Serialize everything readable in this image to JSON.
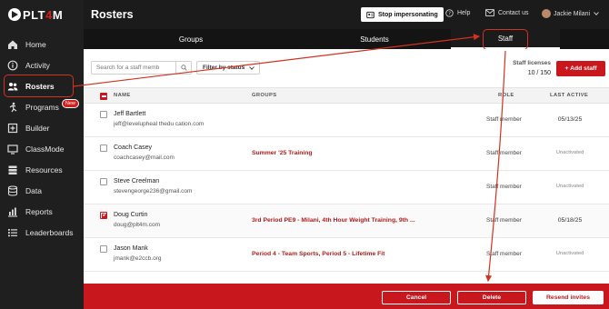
{
  "sidebar": {
    "logo_prefix": "PLT",
    "logo_red": "4",
    "logo_suffix": "M",
    "items": [
      {
        "label": "Home",
        "icon": "home-icon"
      },
      {
        "label": "Activity",
        "icon": "activity-icon"
      },
      {
        "label": "Rosters",
        "icon": "users-icon"
      },
      {
        "label": "Programs",
        "icon": "programs-icon",
        "badge": "New"
      },
      {
        "label": "Builder",
        "icon": "builder-icon"
      },
      {
        "label": "ClassMode",
        "icon": "classmode-icon"
      },
      {
        "label": "Resources",
        "icon": "resources-icon"
      },
      {
        "label": "Data",
        "icon": "data-icon"
      },
      {
        "label": "Reports",
        "icon": "reports-icon"
      },
      {
        "label": "Leaderboards",
        "icon": "leaderboards-icon"
      }
    ]
  },
  "header": {
    "title": "Rosters",
    "stop_impersonating": "Stop impersonating",
    "help": "Help",
    "contact": "Contact us",
    "user": "Jackie Milani"
  },
  "tabs": [
    "Groups",
    "Students",
    "Staff"
  ],
  "toolbar": {
    "search_placeholder": "Search for a staff memb",
    "filter_label": "Filter by status",
    "licenses_label": "Staff licenses",
    "licenses_count": "10 / 150",
    "add_staff": "+ Add staff"
  },
  "table": {
    "headers": {
      "name": "NAME",
      "groups": "GROUPS",
      "role": "ROLE",
      "last_active": "LAST ACTIVE"
    },
    "rows": [
      {
        "name": "Jeff Bartlett",
        "email": "jeff@levelupheal thedu cation.com",
        "groups": "",
        "role": "Staff member",
        "last_active": "05/13/25",
        "checked": false
      },
      {
        "name": "Coach Casey",
        "email": "coachcasey@mail.com",
        "groups": "Summer '25 Training",
        "role": "Staff member",
        "last_active": "Unactivated",
        "checked": false
      },
      {
        "name": "Steve Creelman",
        "email": "stevengeorge236@gmail.com",
        "groups": "",
        "role": "Staff member",
        "last_active": "Unactivated",
        "checked": false
      },
      {
        "name": "Doug Curtin",
        "email": "doug@plt4m.com",
        "groups": "3rd Period PE9 - Milani, 4th Hour Weight Training, 9th ...",
        "role": "Staff member",
        "last_active": "05/18/25",
        "checked": true
      },
      {
        "name": "Jason Mank",
        "email": "jmank@e2ccb.org",
        "groups": "Period 4 - Team Sports, Period 5 - Lifetime Fit",
        "role": "Staff member",
        "last_active": "Unactivated",
        "checked": false
      }
    ]
  },
  "bottom_bar": {
    "cancel": "Cancel",
    "delete": "Delete",
    "resend": "Resend invites"
  },
  "colors": {
    "brand_red": "#c8181e",
    "annotation": "#d2321f",
    "dark": "#1b1b1b"
  }
}
